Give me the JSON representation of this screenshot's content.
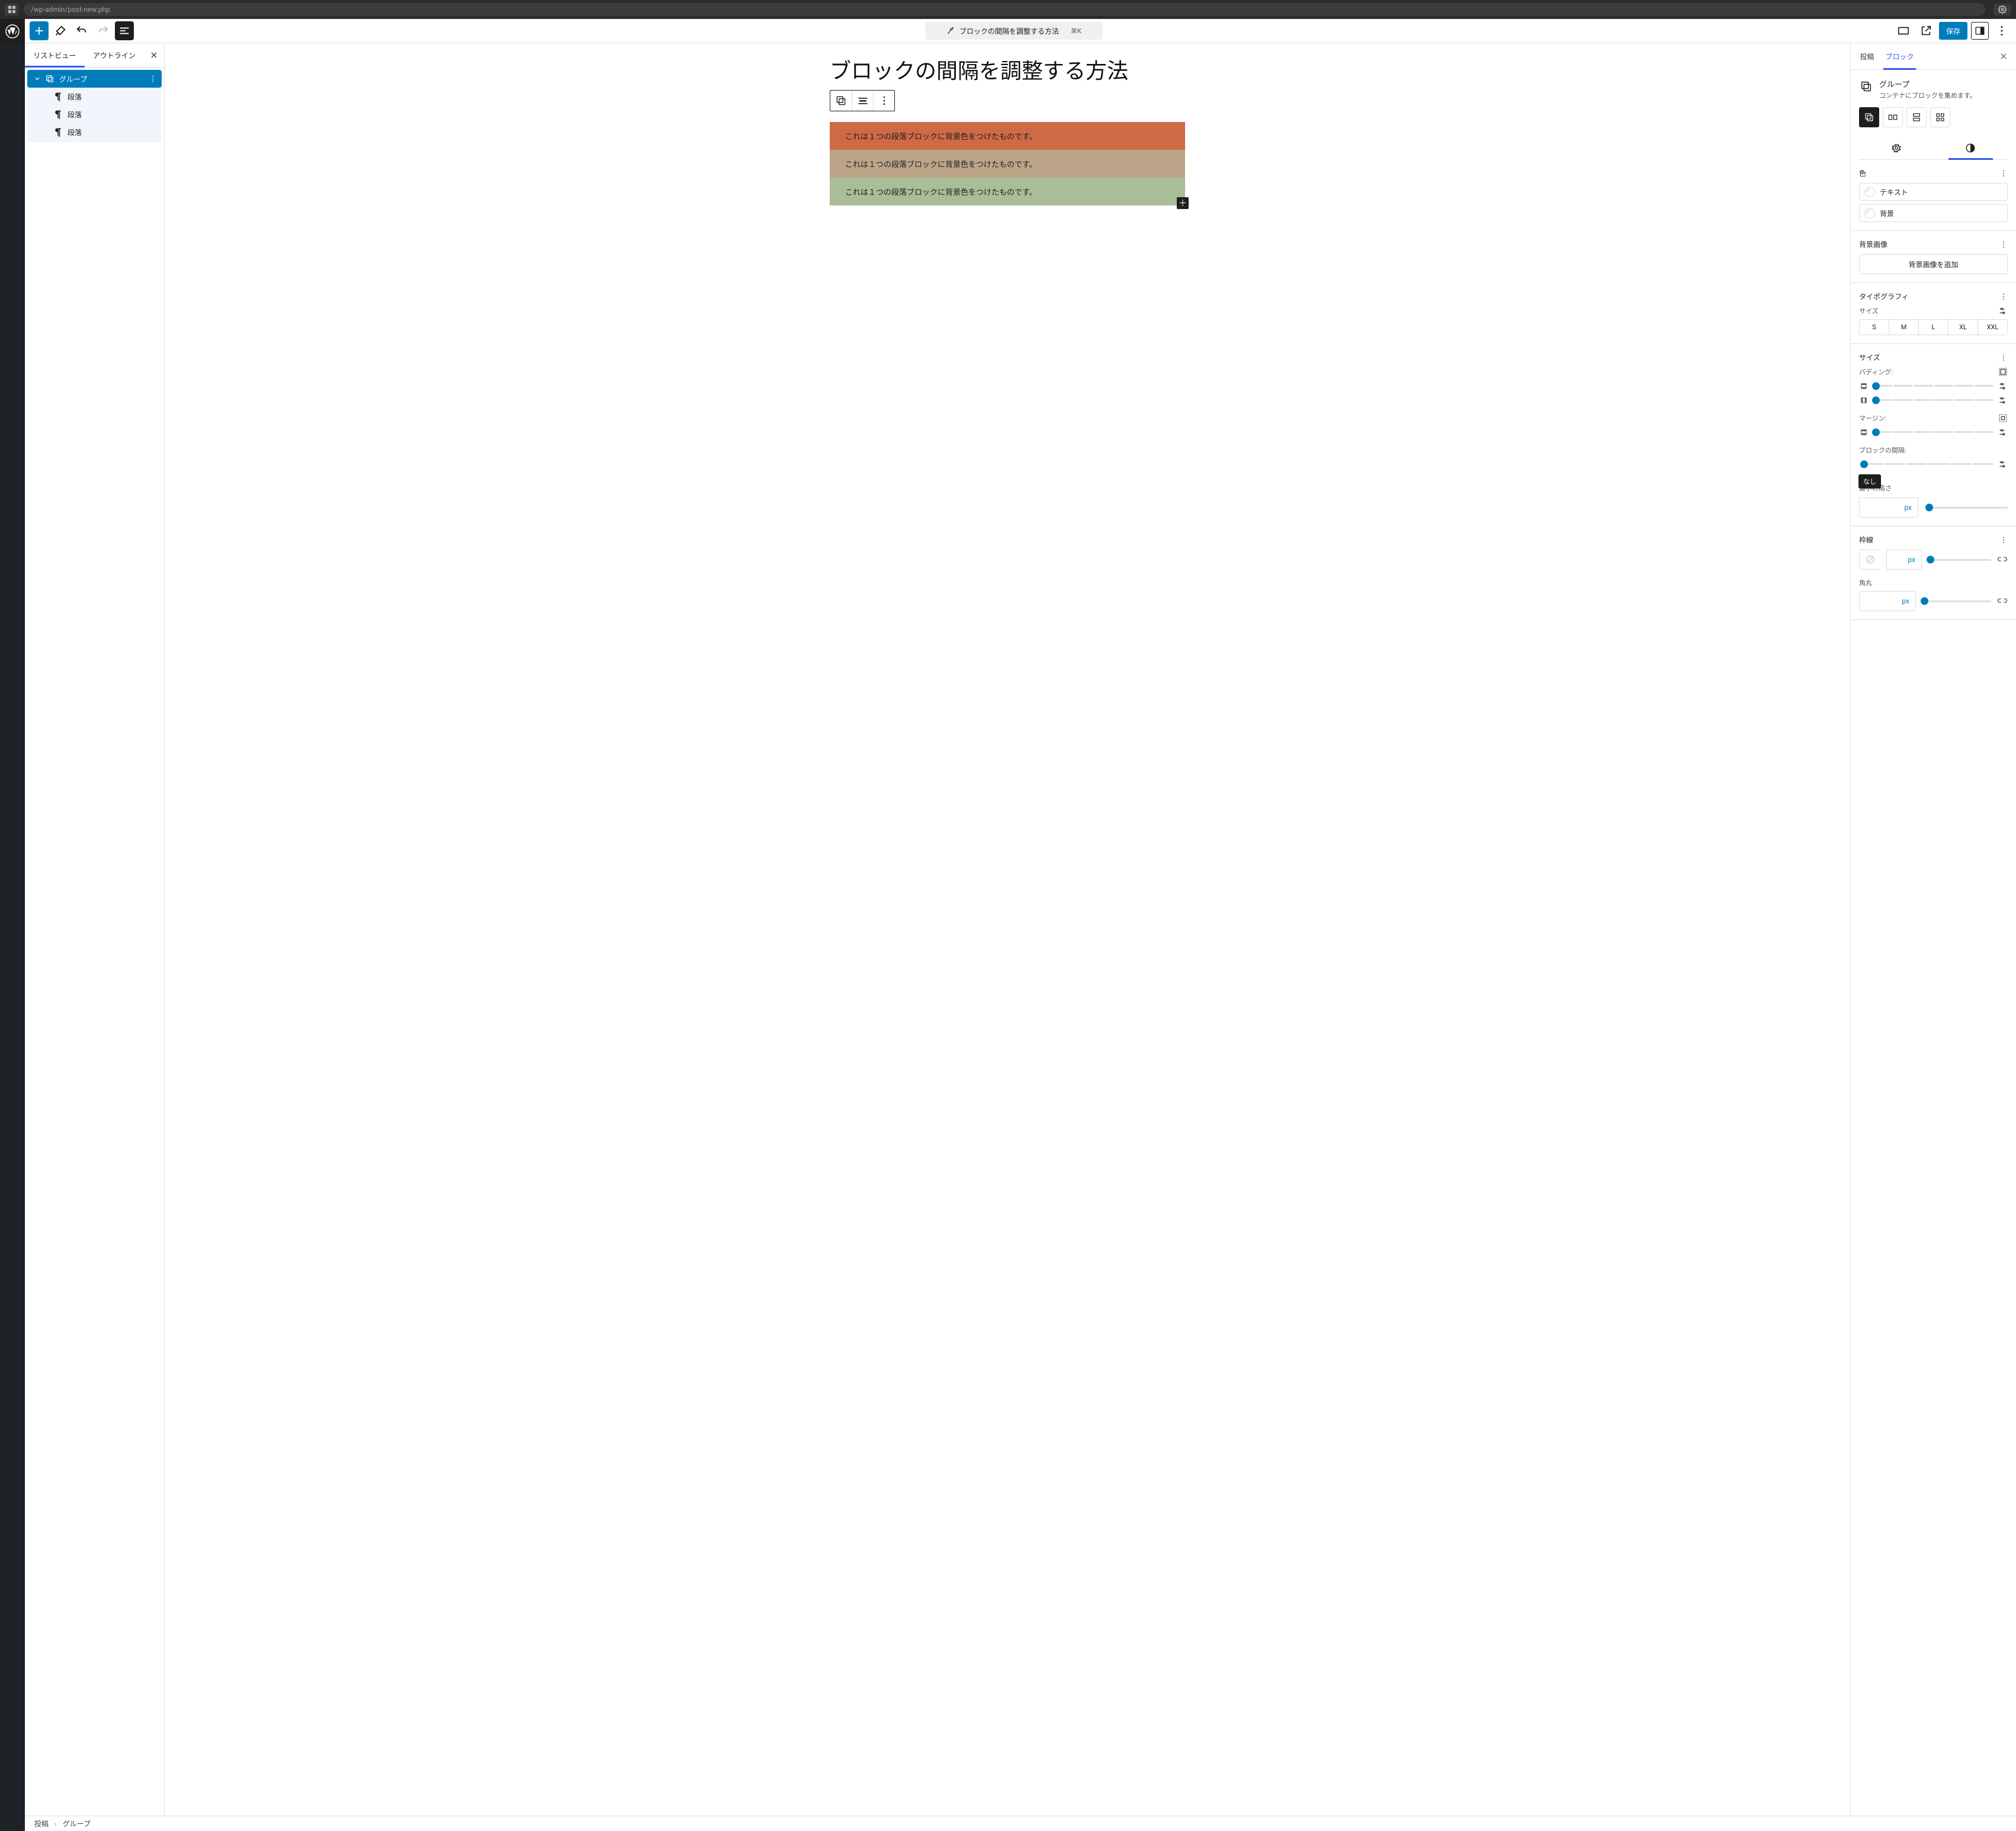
{
  "browser": {
    "url": "/wp-admin/post-new.php"
  },
  "toolbar": {
    "title": "ブロックの間隔を調整する方法",
    "shortcut": "⌘K",
    "save": "保存"
  },
  "left_panel": {
    "tabs": {
      "list": "リストビュー",
      "outline": "アウトライン"
    },
    "tree": {
      "group": "グループ",
      "items": [
        "段落",
        "段落",
        "段落"
      ]
    }
  },
  "canvas": {
    "title": "ブロックの間隔を調整する方法",
    "paras": [
      "これは１つの段落ブロックに背景色をつけたものです。",
      "これは１つの段落ブロックに背景色をつけたものです。",
      "これは１つの段落ブロックに背景色をつけたものです。"
    ]
  },
  "inspector": {
    "tabs": {
      "post": "投稿",
      "block": "ブロック"
    },
    "block_info": {
      "name": "グループ",
      "desc": "コンテナにブロックを集めます。"
    },
    "color": {
      "title": "色",
      "text": "テキスト",
      "background": "背景"
    },
    "bg_image": {
      "title": "背景画像",
      "add": "背景画像を追加"
    },
    "typography": {
      "title": "タイポグラフィ",
      "size": "サイズ",
      "options": [
        "S",
        "M",
        "L",
        "XL",
        "XXL"
      ]
    },
    "size": {
      "title": "サイズ",
      "padding": "パディング:",
      "margin": "マージン:",
      "gap": "ブロックの間隔:",
      "gap_tooltip": "なし",
      "min_height": "最小の高さ",
      "unit": "px"
    },
    "border": {
      "title": "枠線",
      "radius": "角丸",
      "unit": "px"
    }
  },
  "breadcrumbs": {
    "post": "投稿",
    "group": "グループ"
  }
}
